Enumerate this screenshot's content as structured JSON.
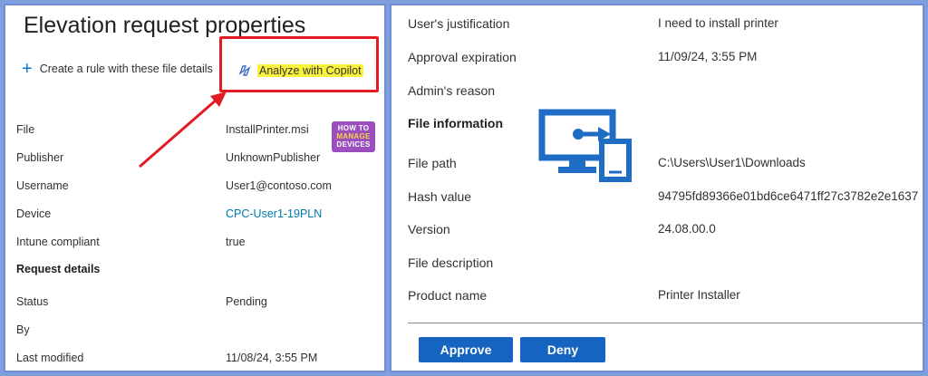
{
  "left": {
    "title": "Elevation request properties",
    "create_rule_label": "Create a rule with these file details",
    "copilot_label": "Analyze with Copilot",
    "logo": {
      "line1": "HOW TO",
      "line2": "MANAGE",
      "line3": "DEVICES"
    },
    "details": [
      {
        "label": "File",
        "value": "InstallPrinter.msi"
      },
      {
        "label": "Publisher",
        "value": "UnknownPublisher"
      },
      {
        "label": "Username",
        "value": "User1@contoso.com"
      },
      {
        "label": "Device",
        "value": "CPC-User1-19PLN"
      },
      {
        "label": "Intune compliant",
        "value": "true"
      }
    ],
    "request_section": "Request details",
    "request": [
      {
        "label": "Status",
        "value": "Pending"
      },
      {
        "label": "By",
        "value": ""
      },
      {
        "label": "Last modified",
        "value": "11/08/24, 3:55 PM"
      }
    ]
  },
  "right": {
    "rows_top": [
      {
        "label": "User's justification",
        "value": "I need to install printer"
      },
      {
        "label": "Approval expiration",
        "value": "11/09/24, 3:55 PM"
      },
      {
        "label": "Admin's reason",
        "value": ""
      }
    ],
    "file_section": "File information",
    "file_rows": [
      {
        "label": "File path",
        "value": "C:\\Users\\User1\\Downloads"
      },
      {
        "label": "Hash value",
        "value": "94795fd89366e01bd6ce6471ff27c3782e2e1637"
      },
      {
        "label": "Version",
        "value": "24.08.00.0"
      },
      {
        "label": "File description",
        "value": ""
      },
      {
        "label": "Product name",
        "value": "Printer Installer"
      }
    ],
    "approve_label": "Approve",
    "deny_label": "Deny"
  },
  "colors": {
    "accent": "#0078d4",
    "highlight": "#fbf23d",
    "callout": "#e11c24",
    "button": "#1565c0",
    "frame": "#7f9fdc"
  },
  "icons": [
    "plus-icon",
    "copilot-icon",
    "remote-device-icon"
  ]
}
